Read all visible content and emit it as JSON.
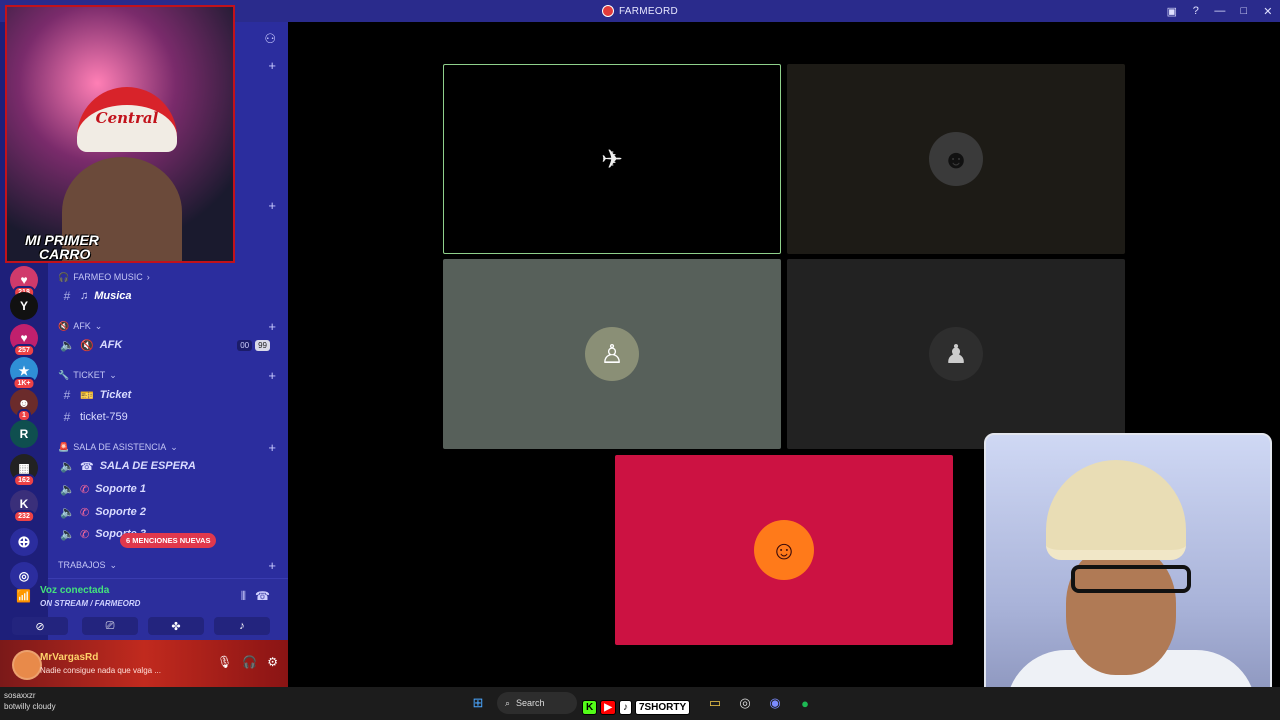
{
  "window": {
    "title": "FARMEORD",
    "controls": [
      "▣",
      "?",
      "—",
      "□",
      "✕"
    ]
  },
  "rail": {
    "servers": [
      {
        "icon": "♥",
        "badge": "218",
        "color": "#d03a6b"
      },
      {
        "icon": "Y",
        "badge": "",
        "color": "#111111"
      },
      {
        "icon": "♥",
        "badge": "257",
        "color": "#c0206d"
      },
      {
        "icon": "★",
        "badge": "1K+",
        "color": "#2f8fd6"
      },
      {
        "icon": "☻",
        "badge": "1",
        "color": "#6b2b2b"
      },
      {
        "icon": "R",
        "badge": "",
        "color": "#0f4f4f"
      },
      {
        "icon": "▦",
        "badge": "162",
        "color": "#222222"
      },
      {
        "icon": "K",
        "badge": "232",
        "color": "#3a2f7a"
      }
    ]
  },
  "sidebar": {
    "categories": {
      "music": "FARMEO MUSIC",
      "afk": "AFK",
      "ticket": "TICKET",
      "assist": "SALA DE ASISTENCIA",
      "jobs": "TRABAJOS"
    },
    "channels": {
      "musica": "Musica",
      "afk": "AFK",
      "ticket": "Ticket",
      "ticket759": "ticket-759",
      "espera": "SALA DE ESPERA",
      "soporte1": "Soporte 1",
      "soporte2": "Soporte 2",
      "soporte3": "Soporte 3"
    },
    "afk_counts": [
      "00",
      "99"
    ],
    "mentions_label": "6 MENCIONES NUEVAS"
  },
  "voice": {
    "status": "Voz conectada",
    "subtitle": "ON STREAM / FARMEORD"
  },
  "user": {
    "name": "MrVargasRd",
    "status": "Nadie consigue nada que valga ..."
  },
  "streamer_cam": {
    "hat_text": "Central",
    "caption_line1": "MI PRIMER",
    "caption_line2": "CARRO"
  },
  "taskbar": {
    "left_line1": "sosaxxzr",
    "left_line2": "botwilly cloudy",
    "search_label": "Search",
    "shorty_label": "7SHORTY"
  }
}
